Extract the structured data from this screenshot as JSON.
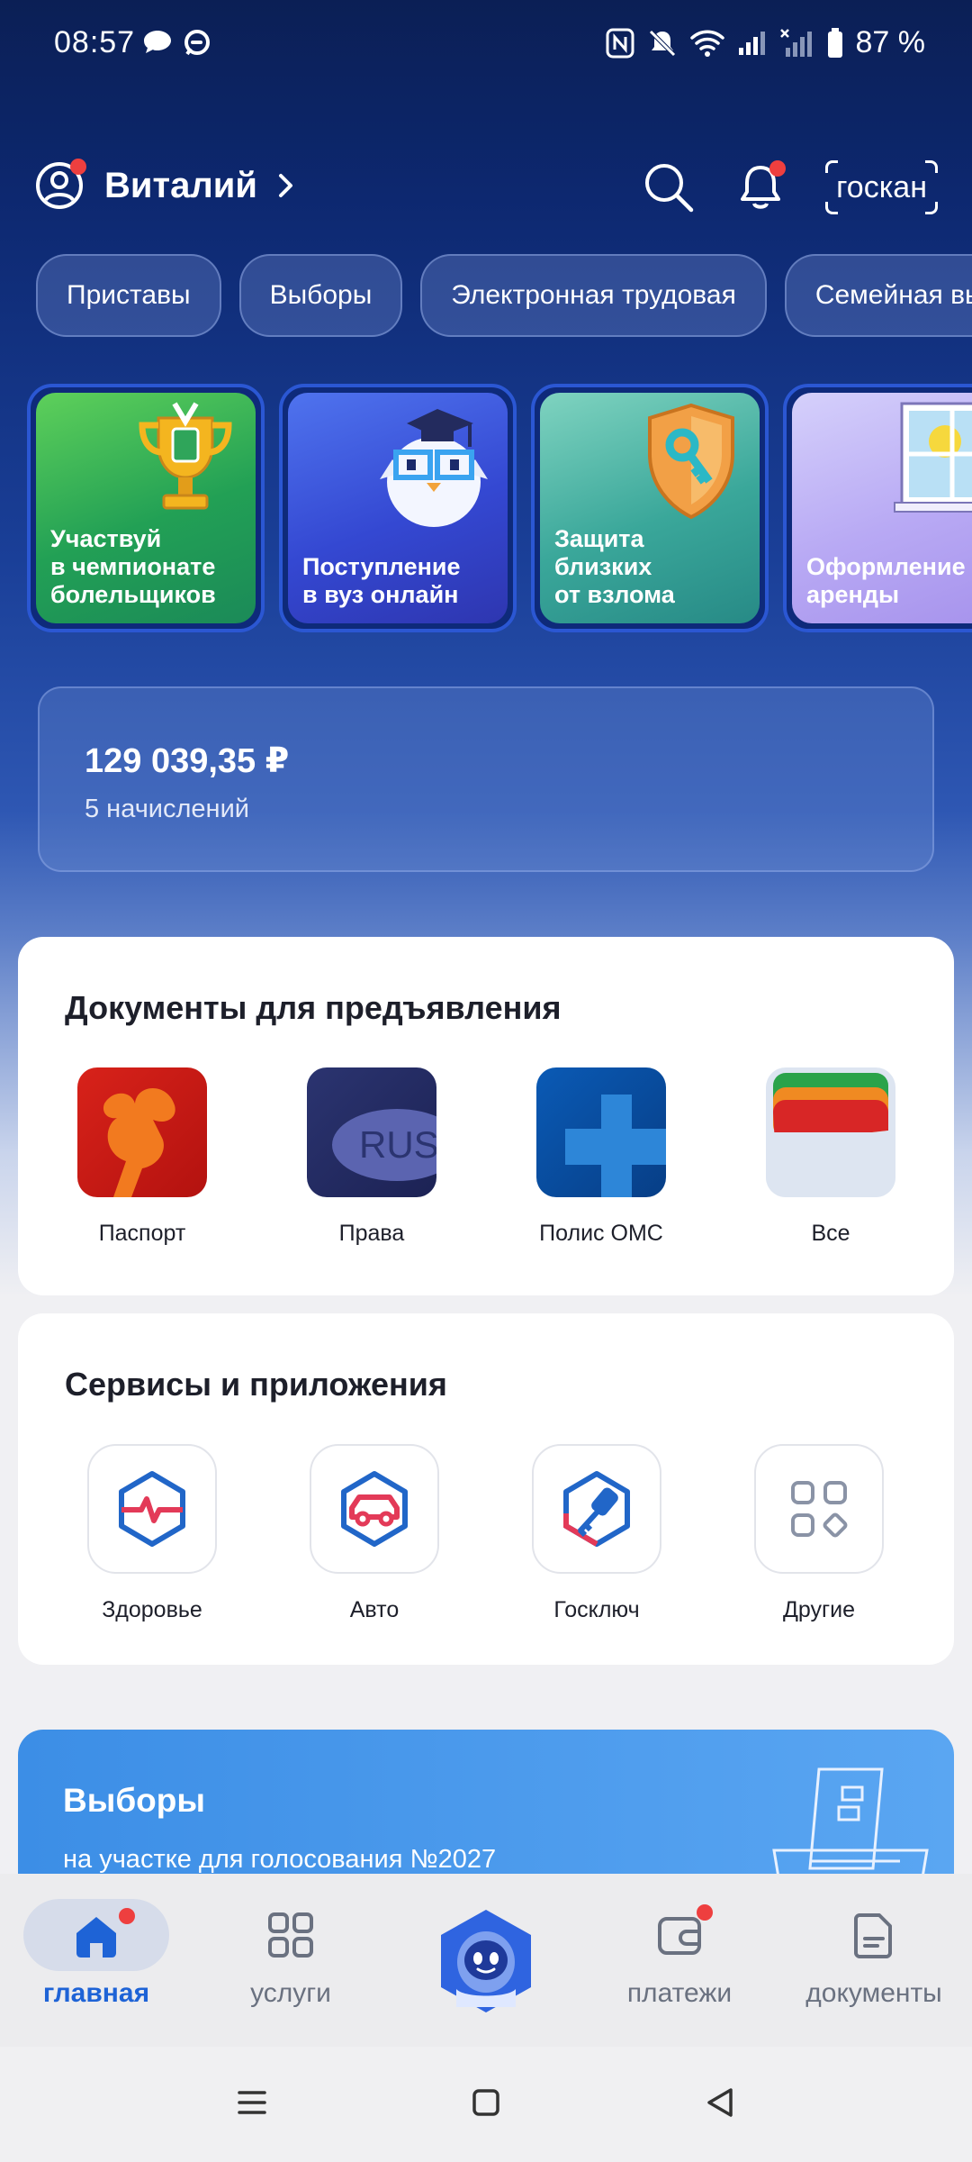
{
  "status_bar": {
    "time": "08:57",
    "battery": "87 %"
  },
  "header": {
    "user_name": "Виталий",
    "goscan_label": "госкан"
  },
  "chips": [
    "Приставы",
    "Выборы",
    "Электронная трудовая",
    "Семейная вы"
  ],
  "promos": [
    {
      "text": "Участвуй\nв чемпионате\nболельщиков",
      "icon": "trophy-icon"
    },
    {
      "text": "Поступление\nв вуз онлайн",
      "icon": "owl-graduate-icon"
    },
    {
      "text": "Защита\nблизких\nот взлома",
      "icon": "shield-key-icon"
    },
    {
      "text": "Оформление\nаренды",
      "icon": "window-icon"
    }
  ],
  "balance": {
    "amount": "129 039,35 ₽",
    "count": "5 начислений"
  },
  "documents": {
    "title": "Документы для предъявления",
    "items": [
      {
        "label": "Паспорт",
        "icon": "passport-icon"
      },
      {
        "label": "Права",
        "icon": "license-icon",
        "plate": "RUS"
      },
      {
        "label": "Полис ОМС",
        "icon": "oms-icon"
      },
      {
        "label": "Все",
        "icon": "all-documents-icon"
      }
    ]
  },
  "services": {
    "title": "Сервисы и приложения",
    "items": [
      {
        "label": "Здоровье",
        "icon": "health-icon"
      },
      {
        "label": "Авто",
        "icon": "car-icon"
      },
      {
        "label": "Госключ",
        "icon": "key-icon"
      },
      {
        "label": "Другие",
        "icon": "grid-icon"
      }
    ]
  },
  "elections": {
    "title": "Выборы",
    "subtitle": "на участке для голосования №2027"
  },
  "bottom_nav": [
    {
      "label": "главная",
      "icon": "home-icon",
      "active": true
    },
    {
      "label": "услуги",
      "icon": "services-grid-icon",
      "active": false
    },
    {
      "label": "",
      "icon": "assistant-robot-icon",
      "active": false
    },
    {
      "label": "платежи",
      "icon": "wallet-icon",
      "active": false
    },
    {
      "label": "документы",
      "icon": "document-icon",
      "active": false
    }
  ],
  "colors": {
    "accent": "#1e63d6",
    "notification_dot": "#ee3f3f",
    "header_bg": "#0d2870"
  }
}
